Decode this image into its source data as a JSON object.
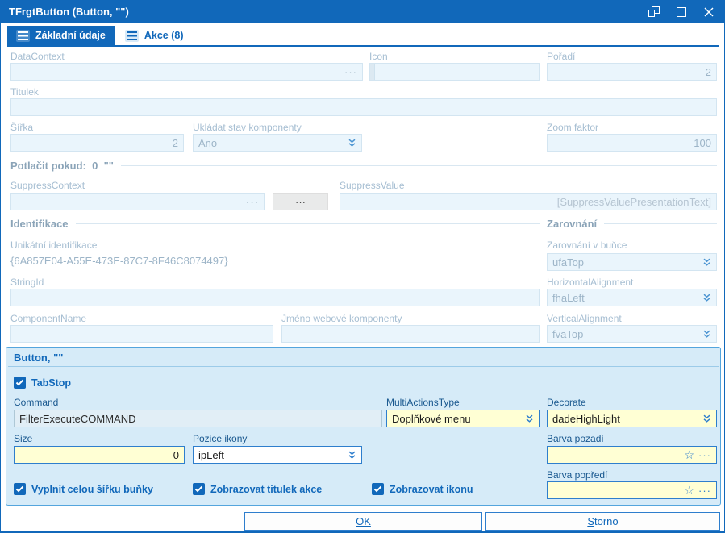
{
  "window": {
    "title": "TFrgtButton (Button, \"\")"
  },
  "tabs": [
    {
      "label": "Základní údaje"
    },
    {
      "label": "Akce (8)"
    }
  ],
  "form": {
    "data_context": {
      "label": "DataContext",
      "value": ""
    },
    "icon": {
      "label": "Icon",
      "value": ""
    },
    "poradi": {
      "label": "Pořadí",
      "value": "2"
    },
    "titulek": {
      "label": "Titulek",
      "value": ""
    },
    "sirka": {
      "label": "Šířka",
      "value": "2"
    },
    "ukladat_stav": {
      "label": "Ukládat stav komponenty",
      "value": "Ano"
    },
    "zoom_faktor": {
      "label": "Zoom faktor",
      "value": "100"
    },
    "suppress_header": "Potlačit pokud:  0  \"\"",
    "suppress_context": {
      "label": "SuppressContext",
      "value": ""
    },
    "suppress_operator": "···",
    "suppress_value": {
      "label": "SuppressValue",
      "value": "[SuppressValuePresentationText]"
    },
    "identifikace_header": "Identifikace",
    "zarovnani_header": "Zarovnání",
    "unikatni_identifikace": {
      "label": "Unikátní identifikace",
      "value": "{6A857E04-A55E-473E-87C7-8F46C8074497}"
    },
    "string_id": {
      "label": "StringId",
      "value": ""
    },
    "component_name": {
      "label": "ComponentName",
      "value": ""
    },
    "jmeno_webove": {
      "label": "Jméno webové komponenty",
      "value": ""
    },
    "zarovnani_v_bunce": {
      "label": "Zarovnání v buňce",
      "value": "ufaTop"
    },
    "horizontal_alignment": {
      "label": "HorizontalAlignment",
      "value": "fhaLeft"
    },
    "vertical_alignment": {
      "label": "VerticalAlignment",
      "value": "fvaTop"
    }
  },
  "button_section": {
    "title": "Button, \"\"",
    "tab_stop": {
      "label": "TabStop",
      "checked": true
    },
    "command": {
      "label": "Command",
      "value": "FilterExecuteCOMMAND"
    },
    "multi_actions_type": {
      "label": "MultiActionsType",
      "value": "Doplňkové menu"
    },
    "decorate": {
      "label": "Decorate",
      "value": "dadeHighLight"
    },
    "size": {
      "label": "Size",
      "value": "0"
    },
    "pozice_ikony": {
      "label": "Pozice ikony",
      "value": "ipLeft"
    },
    "barva_pozadi": {
      "label": "Barva pozadí",
      "value": ""
    },
    "barva_popredi": {
      "label": "Barva popředí",
      "value": ""
    },
    "checkboxes": [
      {
        "label": "Vyplnit celou šířku buňky",
        "checked": true
      },
      {
        "label": "Zobrazovat titulek akce",
        "checked": true
      },
      {
        "label": "Zobrazovat ikonu",
        "checked": true
      }
    ]
  },
  "footer": {
    "ok": "OK",
    "storno_key": "S",
    "storno_rest": "torno"
  },
  "icons": {
    "ellipsis": "···",
    "star": "☆"
  },
  "colors": {
    "accent": "#1168ba",
    "field_highlight": "#ffffd4",
    "panel_bg": "#d6ebf8",
    "titlebar": "#1168ba"
  }
}
